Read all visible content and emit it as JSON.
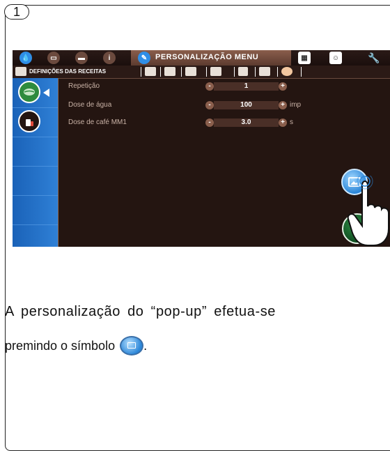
{
  "step": {
    "number": "1"
  },
  "topbar": {
    "title": "PERSONALIZAÇÃO MENU",
    "icons": [
      "water-drop-icon",
      "coffee-icon",
      "milk-icon",
      "info-icon",
      "pencil-icon",
      "calendar-icon",
      "person-icon",
      "wrench-icon"
    ]
  },
  "tabbar": {
    "label": "DEFINIÇÕES DAS RECEITAS"
  },
  "rows": [
    {
      "label": "Repetição",
      "value": "1",
      "unit": ""
    },
    {
      "label": "Dose de água",
      "value": "100",
      "unit": "imp"
    },
    {
      "label": "Dose de café MM1",
      "value": "3.0",
      "unit": "s"
    }
  ],
  "controls": {
    "minus": "-",
    "plus": "+"
  },
  "caption": {
    "line1": "A personalização do “pop-up” efetua-se",
    "line2": "premindo o símbolo",
    "end": "."
  },
  "colors": {
    "screen_bg": "#241511",
    "sidebar_blue": "#2f80d6",
    "accent_brown": "#8a5e4c"
  }
}
